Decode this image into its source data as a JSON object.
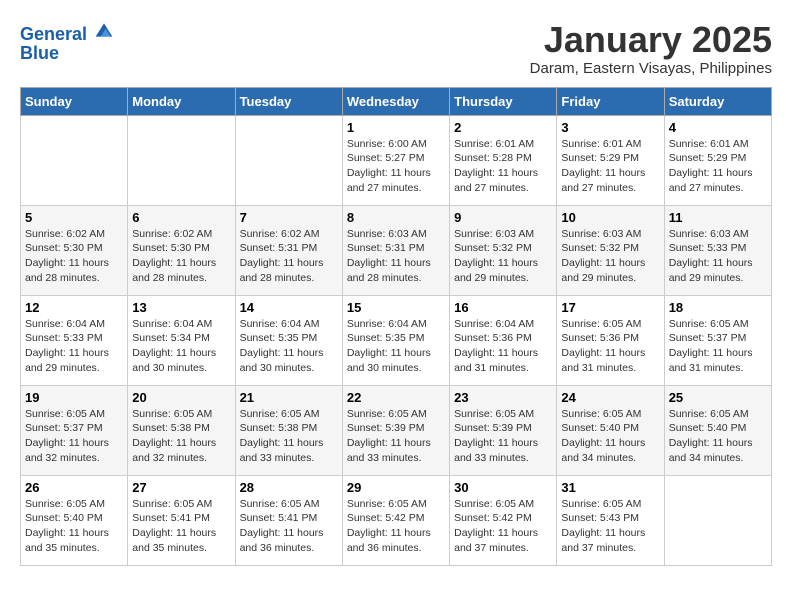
{
  "header": {
    "logo_line1": "General",
    "logo_line2": "Blue",
    "month_title": "January 2025",
    "location": "Daram, Eastern Visayas, Philippines"
  },
  "weekdays": [
    "Sunday",
    "Monday",
    "Tuesday",
    "Wednesday",
    "Thursday",
    "Friday",
    "Saturday"
  ],
  "weeks": [
    [
      {
        "day": "",
        "info": ""
      },
      {
        "day": "",
        "info": ""
      },
      {
        "day": "",
        "info": ""
      },
      {
        "day": "1",
        "info": "Sunrise: 6:00 AM\nSunset: 5:27 PM\nDaylight: 11 hours\nand 27 minutes."
      },
      {
        "day": "2",
        "info": "Sunrise: 6:01 AM\nSunset: 5:28 PM\nDaylight: 11 hours\nand 27 minutes."
      },
      {
        "day": "3",
        "info": "Sunrise: 6:01 AM\nSunset: 5:29 PM\nDaylight: 11 hours\nand 27 minutes."
      },
      {
        "day": "4",
        "info": "Sunrise: 6:01 AM\nSunset: 5:29 PM\nDaylight: 11 hours\nand 27 minutes."
      }
    ],
    [
      {
        "day": "5",
        "info": "Sunrise: 6:02 AM\nSunset: 5:30 PM\nDaylight: 11 hours\nand 28 minutes."
      },
      {
        "day": "6",
        "info": "Sunrise: 6:02 AM\nSunset: 5:30 PM\nDaylight: 11 hours\nand 28 minutes."
      },
      {
        "day": "7",
        "info": "Sunrise: 6:02 AM\nSunset: 5:31 PM\nDaylight: 11 hours\nand 28 minutes."
      },
      {
        "day": "8",
        "info": "Sunrise: 6:03 AM\nSunset: 5:31 PM\nDaylight: 11 hours\nand 28 minutes."
      },
      {
        "day": "9",
        "info": "Sunrise: 6:03 AM\nSunset: 5:32 PM\nDaylight: 11 hours\nand 29 minutes."
      },
      {
        "day": "10",
        "info": "Sunrise: 6:03 AM\nSunset: 5:32 PM\nDaylight: 11 hours\nand 29 minutes."
      },
      {
        "day": "11",
        "info": "Sunrise: 6:03 AM\nSunset: 5:33 PM\nDaylight: 11 hours\nand 29 minutes."
      }
    ],
    [
      {
        "day": "12",
        "info": "Sunrise: 6:04 AM\nSunset: 5:33 PM\nDaylight: 11 hours\nand 29 minutes."
      },
      {
        "day": "13",
        "info": "Sunrise: 6:04 AM\nSunset: 5:34 PM\nDaylight: 11 hours\nand 30 minutes."
      },
      {
        "day": "14",
        "info": "Sunrise: 6:04 AM\nSunset: 5:35 PM\nDaylight: 11 hours\nand 30 minutes."
      },
      {
        "day": "15",
        "info": "Sunrise: 6:04 AM\nSunset: 5:35 PM\nDaylight: 11 hours\nand 30 minutes."
      },
      {
        "day": "16",
        "info": "Sunrise: 6:04 AM\nSunset: 5:36 PM\nDaylight: 11 hours\nand 31 minutes."
      },
      {
        "day": "17",
        "info": "Sunrise: 6:05 AM\nSunset: 5:36 PM\nDaylight: 11 hours\nand 31 minutes."
      },
      {
        "day": "18",
        "info": "Sunrise: 6:05 AM\nSunset: 5:37 PM\nDaylight: 11 hours\nand 31 minutes."
      }
    ],
    [
      {
        "day": "19",
        "info": "Sunrise: 6:05 AM\nSunset: 5:37 PM\nDaylight: 11 hours\nand 32 minutes."
      },
      {
        "day": "20",
        "info": "Sunrise: 6:05 AM\nSunset: 5:38 PM\nDaylight: 11 hours\nand 32 minutes."
      },
      {
        "day": "21",
        "info": "Sunrise: 6:05 AM\nSunset: 5:38 PM\nDaylight: 11 hours\nand 33 minutes."
      },
      {
        "day": "22",
        "info": "Sunrise: 6:05 AM\nSunset: 5:39 PM\nDaylight: 11 hours\nand 33 minutes."
      },
      {
        "day": "23",
        "info": "Sunrise: 6:05 AM\nSunset: 5:39 PM\nDaylight: 11 hours\nand 33 minutes."
      },
      {
        "day": "24",
        "info": "Sunrise: 6:05 AM\nSunset: 5:40 PM\nDaylight: 11 hours\nand 34 minutes."
      },
      {
        "day": "25",
        "info": "Sunrise: 6:05 AM\nSunset: 5:40 PM\nDaylight: 11 hours\nand 34 minutes."
      }
    ],
    [
      {
        "day": "26",
        "info": "Sunrise: 6:05 AM\nSunset: 5:40 PM\nDaylight: 11 hours\nand 35 minutes."
      },
      {
        "day": "27",
        "info": "Sunrise: 6:05 AM\nSunset: 5:41 PM\nDaylight: 11 hours\nand 35 minutes."
      },
      {
        "day": "28",
        "info": "Sunrise: 6:05 AM\nSunset: 5:41 PM\nDaylight: 11 hours\nand 36 minutes."
      },
      {
        "day": "29",
        "info": "Sunrise: 6:05 AM\nSunset: 5:42 PM\nDaylight: 11 hours\nand 36 minutes."
      },
      {
        "day": "30",
        "info": "Sunrise: 6:05 AM\nSunset: 5:42 PM\nDaylight: 11 hours\nand 37 minutes."
      },
      {
        "day": "31",
        "info": "Sunrise: 6:05 AM\nSunset: 5:43 PM\nDaylight: 11 hours\nand 37 minutes."
      },
      {
        "day": "",
        "info": ""
      }
    ]
  ]
}
